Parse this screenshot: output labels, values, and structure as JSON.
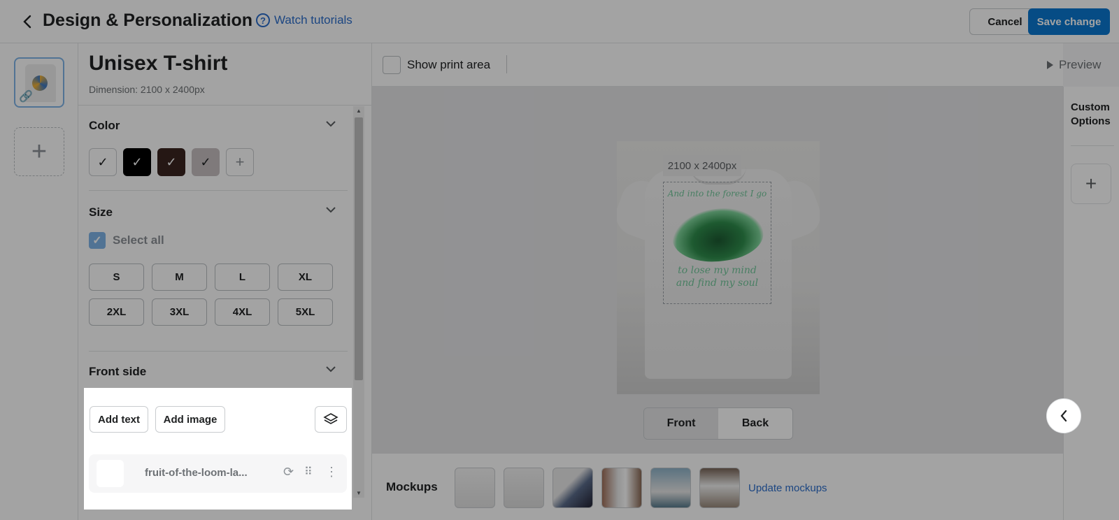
{
  "header": {
    "title": "Design & Personalization",
    "tutorial_link": "Watch tutorials",
    "cancel_label": "Cancel",
    "save_label": "Save change"
  },
  "product": {
    "title": "Unisex T-shirt",
    "dimension": "Dimension: 2100 x 2400px"
  },
  "color_section": {
    "title": "Color",
    "swatches": [
      "#ffffff",
      "#000000",
      "#3a2520",
      "#c7bfc1"
    ],
    "add_label": "+"
  },
  "size_section": {
    "title": "Size",
    "select_all_label": "Select all",
    "select_all_checked": true,
    "sizes": [
      "S",
      "M",
      "L",
      "XL",
      "2XL",
      "3XL",
      "4XL",
      "5XL"
    ]
  },
  "front_section": {
    "title": "Front side",
    "add_text_label": "Add text",
    "add_image_label": "Add image",
    "layer_name": "fruit-of-the-loom-la..."
  },
  "toolbar": {
    "show_print_area_label": "Show print area",
    "preview_label": "Preview"
  },
  "canvas": {
    "dimension_badge": "2100 x 2400px",
    "design_line1": "And into the forest I go",
    "design_line2": "to lose my mind",
    "design_line3": "and find my soul"
  },
  "side_toggle": {
    "front_label": "Front",
    "back_label": "Back",
    "active": "Front"
  },
  "mockups": {
    "label": "Mockups",
    "update_label": "Update mockups"
  },
  "custom_options": {
    "title": "Custom Options",
    "add_label": "+"
  },
  "colors": {
    "accent": "#0a78d1",
    "link": "#2c6ecb"
  }
}
